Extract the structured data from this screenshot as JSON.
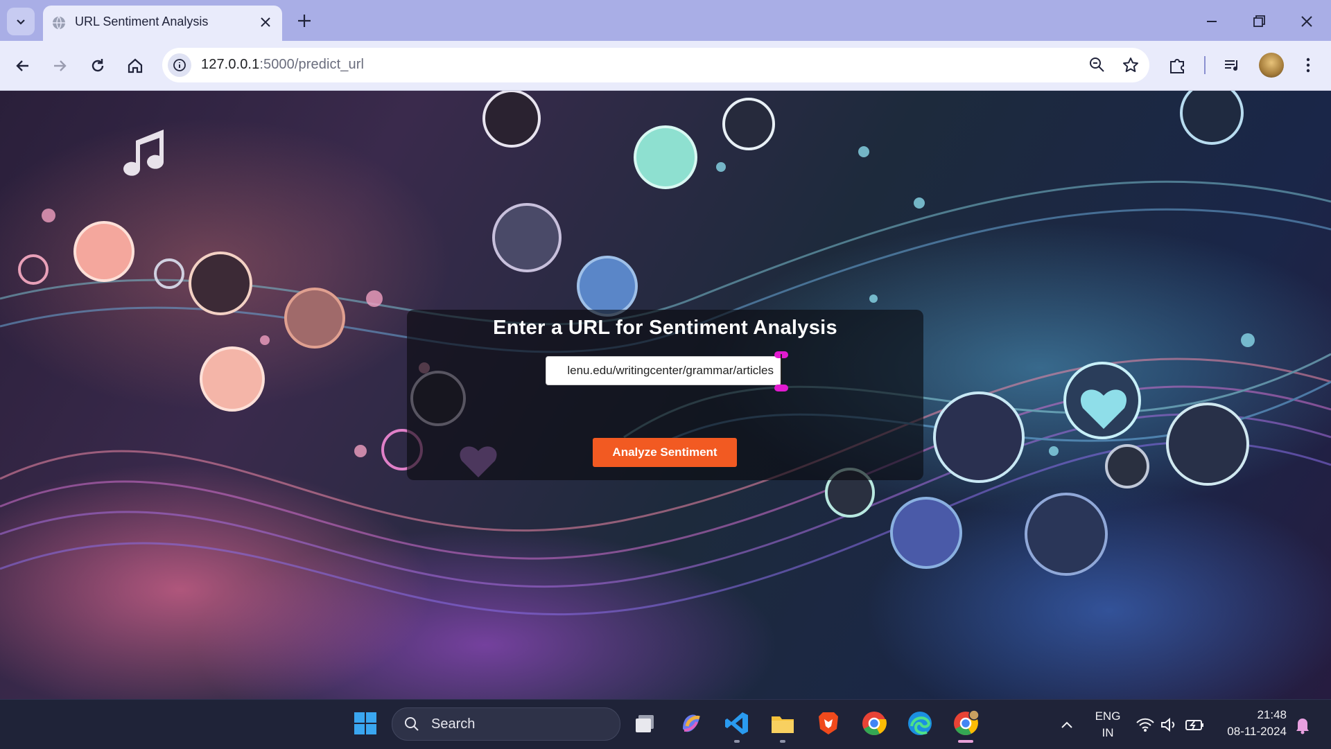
{
  "browser": {
    "tab": {
      "title": "URL Sentiment Analysis"
    },
    "address_bar": {
      "host": "127.0.0.1",
      "path": ":5000/predict_url"
    }
  },
  "page": {
    "heading": "Enter a URL for Sentiment Analysis",
    "url_input_value": "lenu.edu/writingcenter/grammar/articles",
    "submit_label": "Analyze Sentiment"
  },
  "taskbar": {
    "search_placeholder": "Search",
    "language_line1": "ENG",
    "language_line2": "IN",
    "time": "21:48",
    "date": "08-11-2024"
  },
  "colors": {
    "tab_strip": "#a9aee6",
    "toolbar": "#e9ebfb",
    "button": "#f25a22",
    "taskbar": "#1f2338"
  }
}
